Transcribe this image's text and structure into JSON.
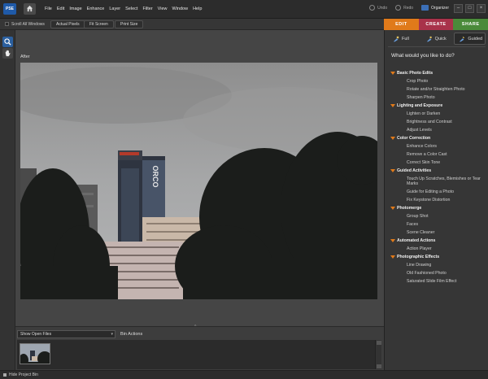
{
  "app": {
    "logo_text": "PSE",
    "menus": [
      "File",
      "Edit",
      "Image",
      "Enhance",
      "Layer",
      "Select",
      "Filter",
      "View",
      "Window",
      "Help"
    ],
    "undo_label": "Undo",
    "redo_label": "Redo",
    "organizer_label": "Organizer",
    "window_buttons": [
      "–",
      "□",
      "×"
    ]
  },
  "toolbar": {
    "scroll_all_label": "Scroll All Windows",
    "actual_pixels_label": "Actual Pixels",
    "fit_screen_label": "Fit Screen",
    "print_size_label": "Print Size"
  },
  "tabs": [
    {
      "label": "EDIT",
      "color": "#e07a1a"
    },
    {
      "label": "CREATE",
      "color": "#a8324a"
    },
    {
      "label": "SHARE",
      "color": "#4a8a3a"
    }
  ],
  "canvas": {
    "view_label": "After",
    "split_handle": "^"
  },
  "bin": {
    "select_value": "Show Open Files",
    "actions_label": "Bin Actions"
  },
  "status": {
    "hide_bin_label": "Hide Project Bin"
  },
  "panel": {
    "modes": [
      {
        "label": "Full",
        "icon": "full-edit-icon",
        "active": false
      },
      {
        "label": "Quick",
        "icon": "quick-edit-icon",
        "active": false
      },
      {
        "label": "Guided",
        "icon": "guided-edit-icon",
        "active": true
      }
    ],
    "question": "What would you like to do?",
    "categories": [
      {
        "label": "Basic Photo Edits",
        "items": [
          "Crop Photo",
          "Rotate and/or Straighten Photo",
          "Sharpen Photo"
        ]
      },
      {
        "label": "Lighting and Exposure",
        "items": [
          "Lighten or Darken",
          "Brightness and Contrast",
          "Adjust Levels"
        ]
      },
      {
        "label": "Color Correction",
        "items": [
          "Enhance Colors",
          "Remove a Color Cast",
          "Correct Skin Tone"
        ]
      },
      {
        "label": "Guided Activities",
        "items": [
          "Touch Up Scratches, Blemishes or Tear Marks",
          "Guide for Editing a Photo",
          "Fix Keystone Distortion"
        ]
      },
      {
        "label": "Photomerge",
        "items": [
          "Group Shot",
          "Faces",
          "Scene Cleaner"
        ]
      },
      {
        "label": "Automated Actions",
        "items": [
          "Action Player"
        ]
      },
      {
        "label": "Photographic Effects",
        "items": [
          "Line Drawing",
          "Old Fashioned Photo",
          "Saturated Slide Film Effect"
        ]
      }
    ]
  },
  "photo": {
    "building_sign": "ORCO"
  }
}
